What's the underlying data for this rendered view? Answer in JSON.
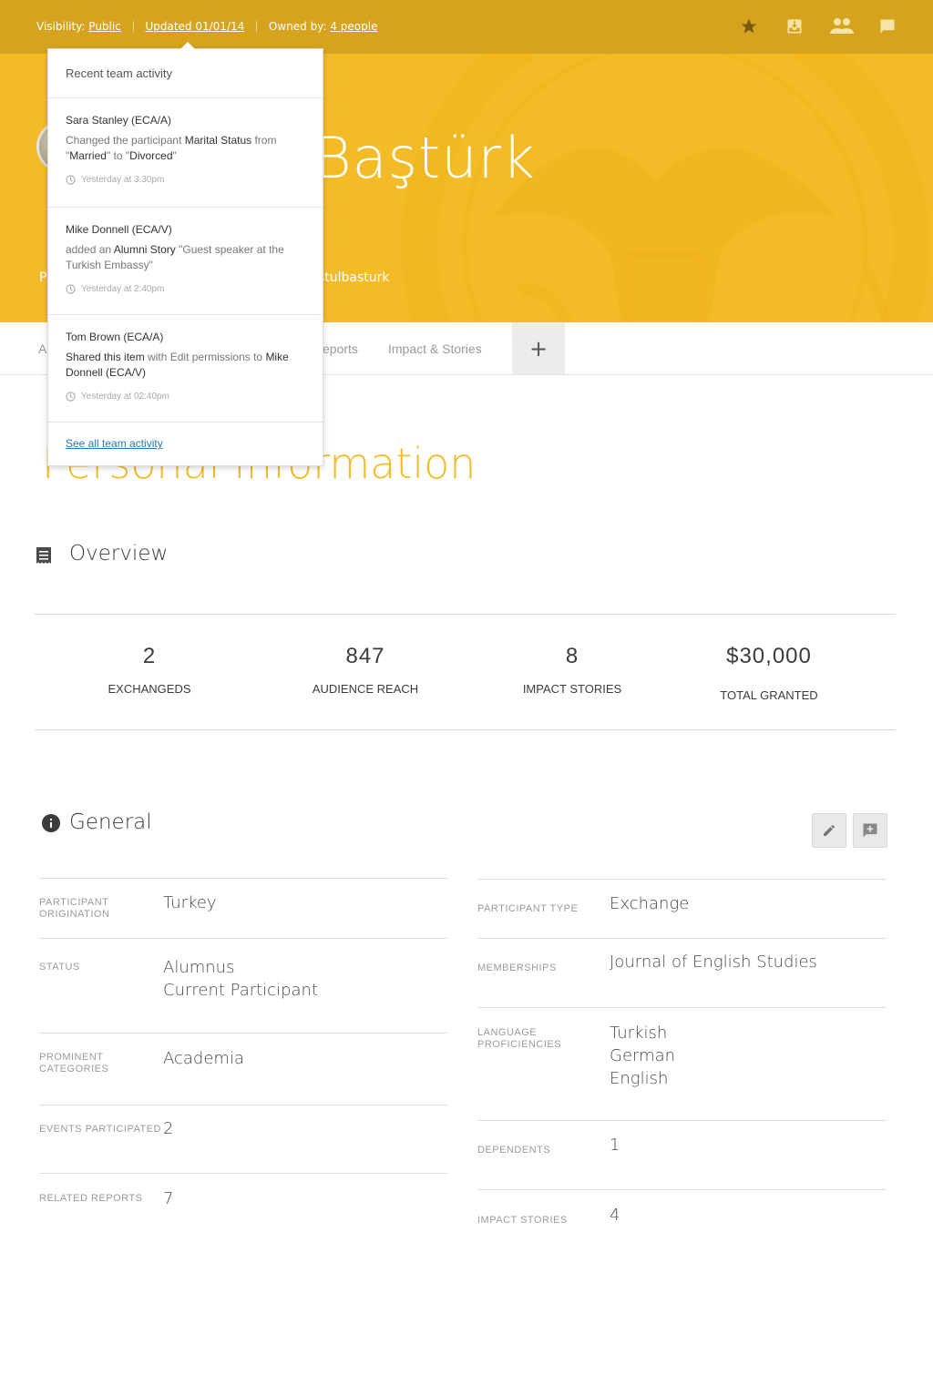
{
  "topbar": {
    "visibility_label": "Visibility:",
    "visibility_value": "Public",
    "updated": "Updated 01/01/14",
    "owned_label": "Owned by:",
    "owned_value": "4 people",
    "icons": [
      "star-icon",
      "inbox-download-icon",
      "people-icon",
      "comment-icon"
    ]
  },
  "hero": {
    "name_visible": "Baştürk",
    "left_letter": "P",
    "handle_visible": "stulbasturk"
  },
  "tabs": {
    "items": [
      "A",
      "eports",
      "Impact & Stories"
    ],
    "add_label": "+"
  },
  "page": {
    "section_title": "Personal Information"
  },
  "overview": {
    "title": "Overview",
    "stats": [
      {
        "value": "2",
        "label": "Exchangeds"
      },
      {
        "value": "847",
        "label": "Audience Reach"
      },
      {
        "value": "8",
        "label": "Impact Stories"
      },
      {
        "value": "$30,000",
        "label": "Total Granted"
      }
    ]
  },
  "general": {
    "title": "General",
    "left": [
      {
        "label": "Participant Origination",
        "values": [
          "Turkey"
        ]
      },
      {
        "label": "Status",
        "values": [
          "Alumnus",
          "Current Participant"
        ]
      },
      {
        "label": "Prominent Categories",
        "values": [
          "Academia"
        ]
      },
      {
        "label": "Events Participated",
        "values": [
          "2"
        ]
      },
      {
        "label": "Related Reports",
        "values": [
          "7"
        ]
      }
    ],
    "right": [
      {
        "label": "Participant Type",
        "values": [
          "Exchange"
        ]
      },
      {
        "label": "Memberships",
        "values": [
          "Journal of English Studies"
        ]
      },
      {
        "label": "Language Proficiencies",
        "values": [
          "Turkish",
          "German",
          "English"
        ]
      },
      {
        "label": "Dependents",
        "values": [
          "1"
        ]
      },
      {
        "label": "Impact Stories",
        "values": [
          "4"
        ]
      }
    ]
  },
  "activity": {
    "title": "Recent team activity",
    "items": [
      {
        "who": "Sara Stanley (ECA/A)",
        "parts": [
          "Changed the participant ",
          "Marital Status",
          " from \"",
          "Married",
          "\" to \"",
          "Divorced",
          "\""
        ],
        "when": "Yesterday at 3:30pm"
      },
      {
        "who": "Mike Donnell (ECA/V)",
        "parts": [
          "added an ",
          "Alumni Story",
          " \"Guest speaker at the Turkish Embassy\""
        ],
        "when": "Yesterday at 2:40pm"
      },
      {
        "who": "Tom Brown (ECA/A)",
        "parts": [
          "",
          "Shared this item",
          " with Edit permissions to ",
          "Mike Donnell (ECA/V)",
          ""
        ],
        "when": "Yesterday at 02:40pm"
      }
    ],
    "footer_link": "See all team activity"
  },
  "colors": {
    "topbar": "#d6a31f",
    "hero": "#f3bc26",
    "accent_title": "#f3bc26",
    "link": "#2a76b5"
  }
}
